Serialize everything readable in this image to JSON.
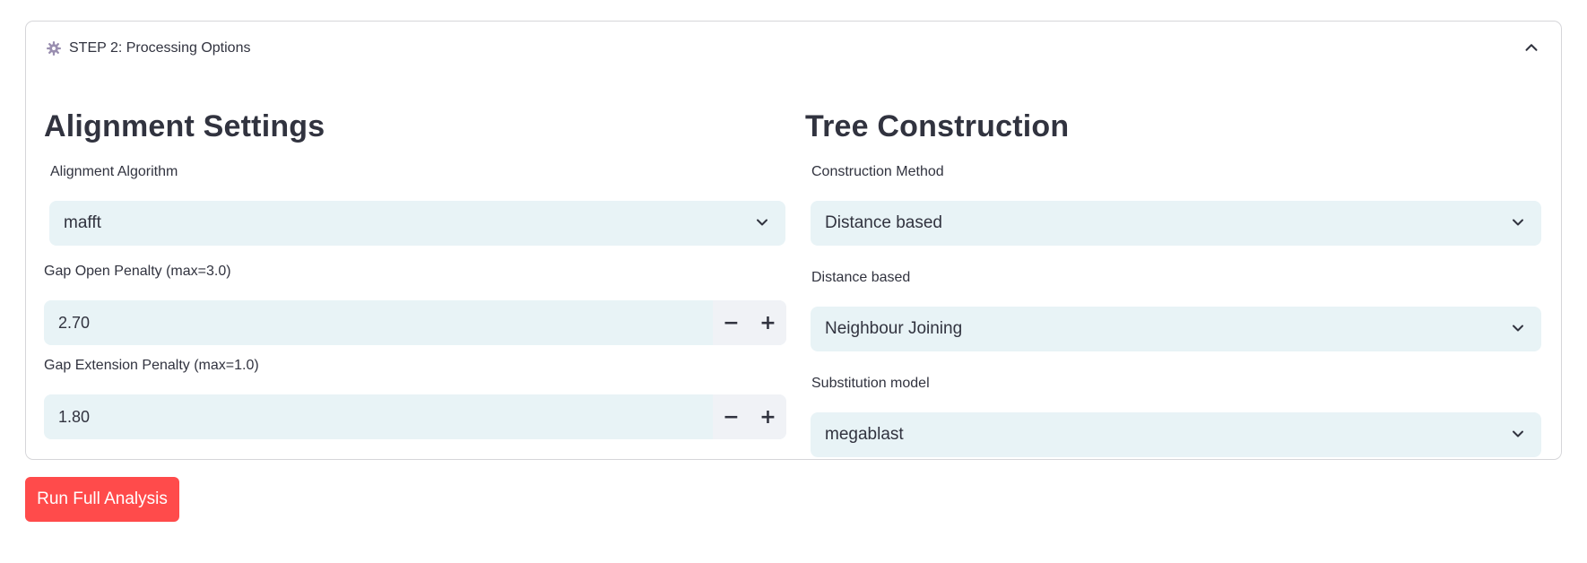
{
  "expander": {
    "title": "STEP 2: Processing Options",
    "icon": "gear-icon",
    "expanded": true
  },
  "alignment": {
    "title": "Alignment Settings",
    "algorithm": {
      "label": "Alignment Algorithm",
      "value": "mafft"
    },
    "gap_open": {
      "label": "Gap Open Penalty (max=3.0)",
      "value": "2.70",
      "decrement": "−",
      "increment": "+"
    },
    "gap_extension": {
      "label": "Gap Extension Penalty (max=1.0)",
      "value": "1.80",
      "decrement": "−",
      "increment": "+"
    }
  },
  "tree": {
    "title": "Tree Construction",
    "construction_method": {
      "label": "Construction Method",
      "value": "Distance based"
    },
    "distance_based": {
      "label": "Distance based",
      "value": "Neighbour Joining"
    },
    "substitution_model": {
      "label": "Substitution model",
      "value": "megablast"
    }
  },
  "run_button": {
    "label": "Run Full Analysis"
  },
  "colors": {
    "primary": "#ff4b4b",
    "input_bg": "#e8f3f6",
    "stepper_bg": "#f0f2f6",
    "text": "#31333f",
    "border": "#d6d6d9"
  }
}
